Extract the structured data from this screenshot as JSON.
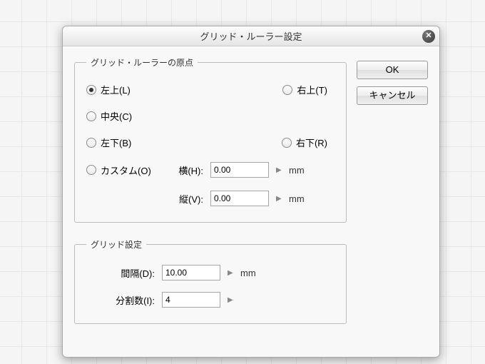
{
  "title": "グリッド・ルーラー設定",
  "groups": {
    "origin": {
      "legend": "グリッド・ルーラーの原点",
      "options": {
        "tl": "左上(L)",
        "tr": "右上(T)",
        "center": "中央(C)",
        "bl": "左下(B)",
        "br": "右下(R)",
        "custom": "カスタム(O)"
      },
      "selected": "tl",
      "horiz": {
        "label": "横(H):",
        "value": "0.00",
        "unit": "mm"
      },
      "vert": {
        "label": "縦(V):",
        "value": "0.00",
        "unit": "mm"
      }
    },
    "grid": {
      "legend": "グリッド設定",
      "spacing": {
        "label": "間隔(D):",
        "value": "10.00",
        "unit": "mm"
      },
      "divisions": {
        "label": "分割数(I):",
        "value": "4"
      }
    }
  },
  "buttons": {
    "ok": "OK",
    "cancel": "キャンセル"
  }
}
